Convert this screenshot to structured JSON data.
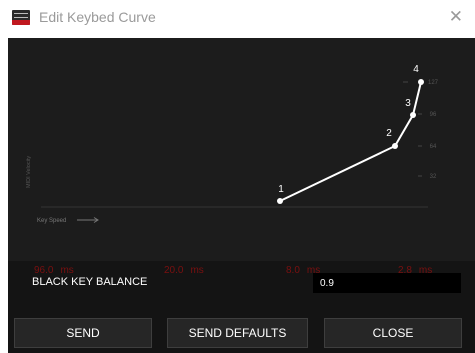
{
  "window": {
    "title": "Edit Keybed Curve",
    "close_glyph": "✕"
  },
  "graph": {
    "y_axis_label": "MIDI Velocity",
    "x_axis_label": "Key Speed",
    "y_ticks": [
      "127",
      "96",
      "64",
      "32"
    ],
    "points": [
      {
        "label": "1",
        "key_speed_ms": "8.0",
        "velocity": 6
      },
      {
        "label": "2",
        "key_speed_ms": "2.8",
        "velocity": 62
      },
      {
        "label": "3",
        "key_speed_ms": "2.8",
        "velocity": 94
      },
      {
        "label": "4",
        "key_speed_ms": "2.8",
        "velocity": 127
      }
    ],
    "curve_color": "#ffffff",
    "background_color": "#1c1c1c"
  },
  "timings": [
    {
      "value": "96.0",
      "unit": "ms"
    },
    {
      "value": "20.0",
      "unit": "ms"
    },
    {
      "value": "8.0",
      "unit": "ms"
    },
    {
      "value": "2.8",
      "unit": "ms"
    }
  ],
  "timing_color": "#7a1010",
  "black_key_balance": {
    "label": "BLACK KEY BALANCE",
    "value": "0.9"
  },
  "buttons": {
    "send": "SEND",
    "send_defaults": "SEND DEFAULTS",
    "close": "CLOSE"
  }
}
